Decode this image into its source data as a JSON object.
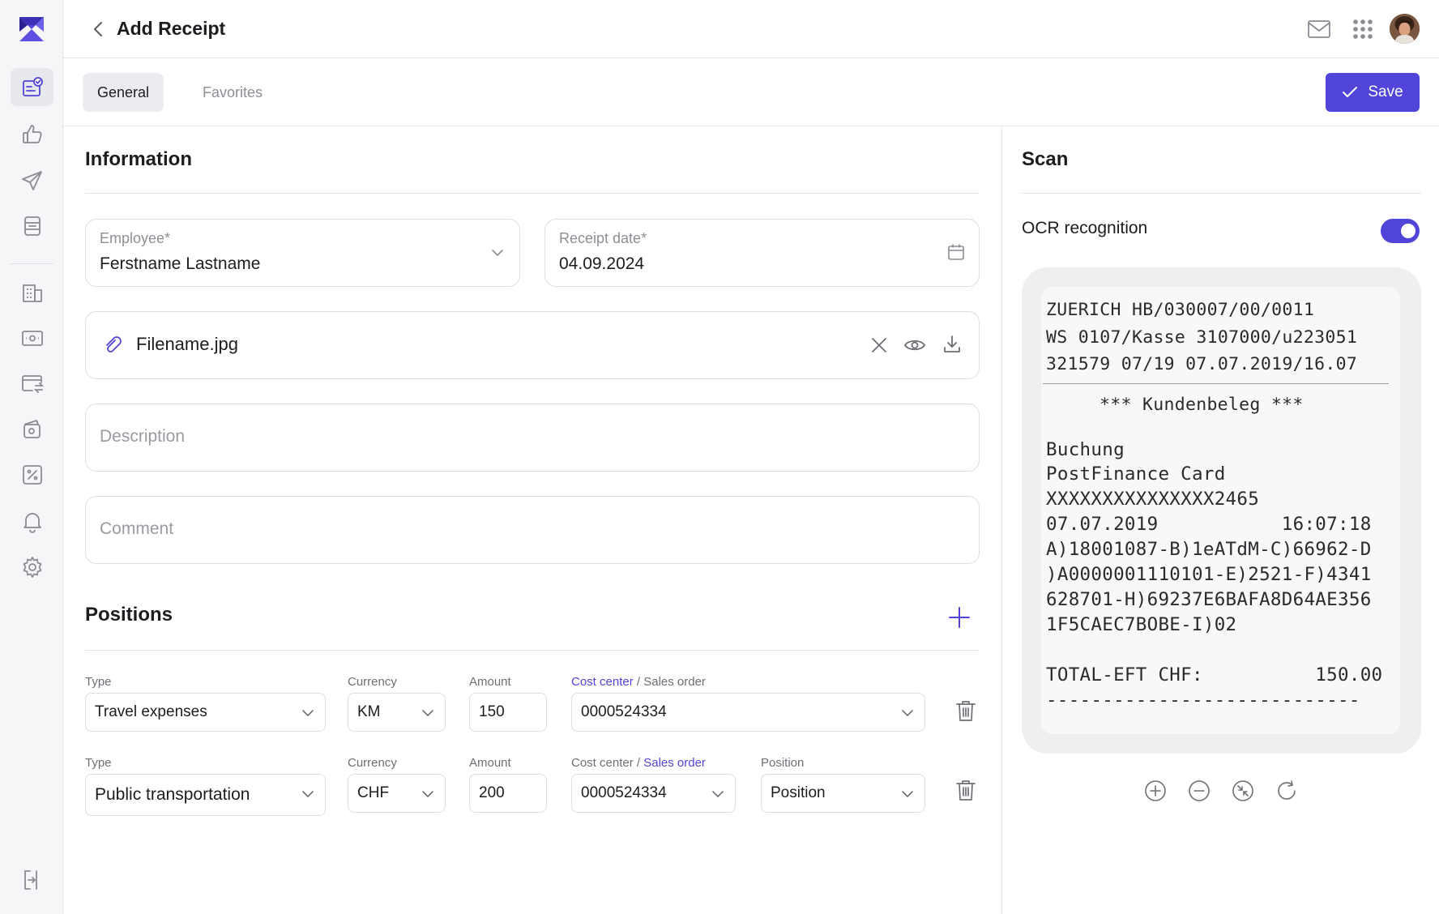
{
  "header": {
    "title": "Add Receipt"
  },
  "tabs": [
    {
      "label": "General"
    },
    {
      "label": "Favorites"
    }
  ],
  "toolbar": {
    "save_label": "Save"
  },
  "colors": {
    "accent": "#5144d8"
  },
  "sidebar": {
    "items": [
      {
        "icon": "receipt-check-icon",
        "active": true
      },
      {
        "icon": "thumbs-up-icon"
      },
      {
        "icon": "paper-plane-icon"
      },
      {
        "icon": "document-list-icon"
      },
      {
        "icon": "building-icon"
      },
      {
        "icon": "banknote-icon"
      },
      {
        "icon": "card-transfer-icon"
      },
      {
        "icon": "wallet-tag-icon"
      },
      {
        "icon": "percent-icon"
      },
      {
        "icon": "bell-icon"
      },
      {
        "icon": "gear-icon"
      },
      {
        "icon": "logout-icon"
      }
    ]
  },
  "information": {
    "title": "Information",
    "employee": {
      "label": "Employee*",
      "value": "Ferstname Lastname"
    },
    "receipt_date": {
      "label": "Receipt date*",
      "value": "04.09.2024"
    },
    "attachment": {
      "filename": "Filename.jpg"
    },
    "description": {
      "placeholder": "Description"
    },
    "comment": {
      "placeholder": "Comment"
    }
  },
  "positions": {
    "title": "Positions",
    "rows": [
      {
        "type_label": "Type",
        "type": "Travel expenses",
        "currency_label": "Currency",
        "currency": "KM",
        "amount_label": "Amount",
        "amount": "150",
        "cost_center_label": "Cost center",
        "sales_order_label": "Sales order",
        "separator": "/",
        "cost_center": "0000524334"
      },
      {
        "type_label": "Type",
        "type": "Public transportation",
        "currency_label": "Currency",
        "currency": "CHF",
        "amount_label": "Amount",
        "amount": "200",
        "cost_center_label": "Cost center",
        "sales_order_label": "Sales order",
        "separator": "/",
        "cost_center": "0000524334",
        "position_label": "Position",
        "position": "Position"
      }
    ]
  },
  "scan": {
    "title": "Scan",
    "ocr_label": "OCR recognition",
    "ocr_enabled": true,
    "receipt_lines": {
      "l1": "ZUERICH HB/030007/00/0011",
      "l2": "WS 0107/Kasse 3107000/u223051",
      "l3": "321579 07/19 07.07.2019/16.07",
      "l4": "*** Kundenbeleg ***",
      "l5": "Buchung",
      "l6": "PostFinance Card",
      "l7": "XXXXXXXXXXXXXXX2465",
      "l8": "07.07.2019           16:07:18",
      "l9": "A)18001087-B)1eATdM-C)66962-D",
      "l10": ")A0000001110101-E)2521-F)4341",
      "l11": "628701-H)69237E6BAFA8D64AE356",
      "l12": "1F5CAEC7BOBE-I)02",
      "l13": "TOTAL-EFT CHF:          150.00",
      "l14": "----------------------------"
    }
  }
}
